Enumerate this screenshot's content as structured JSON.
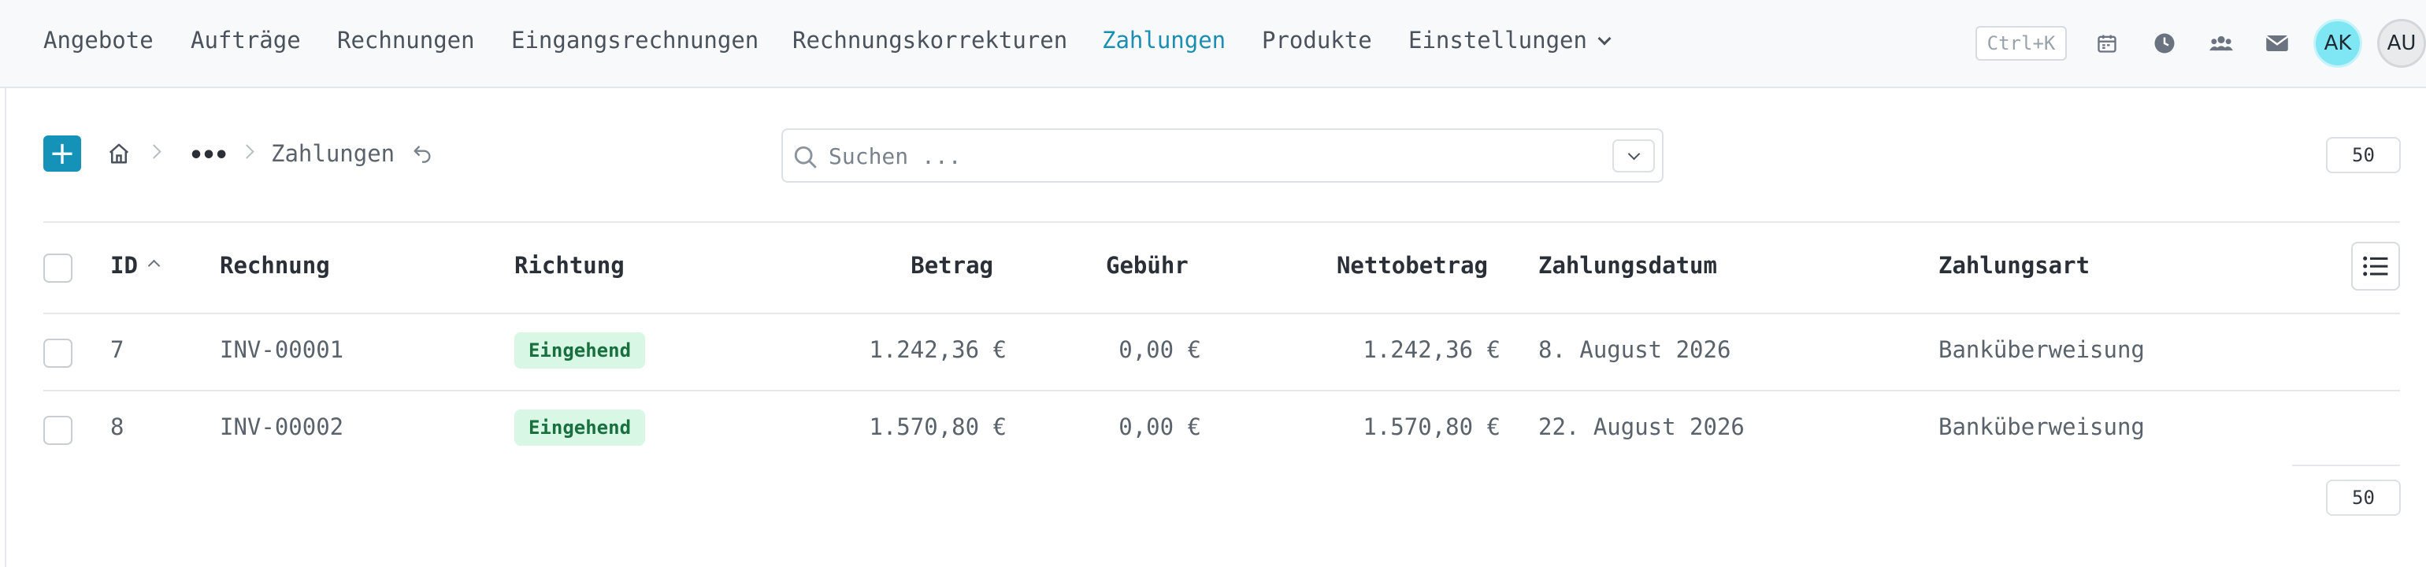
{
  "nav": {
    "items": [
      "Angebote",
      "Aufträge",
      "Rechnungen",
      "Eingangsrechnungen",
      "Rechnungskorrekturen",
      "Zahlungen",
      "Produkte",
      "Einstellungen"
    ],
    "active": "Zahlungen",
    "shortcut": "Ctrl+K",
    "icons": [
      "calendar-icon",
      "clock-icon",
      "team-icon",
      "mail-icon"
    ],
    "avatars": [
      "AK",
      "AU"
    ]
  },
  "toolbar": {
    "add_label": "+",
    "breadcrumb_current": "Zahlungen",
    "breadcrumb_more": "•••",
    "search_placeholder": "Suchen ...",
    "page_size_top": "50",
    "page_size_bottom": "50"
  },
  "table": {
    "headers": {
      "id": "ID",
      "rechnung": "Rechnung",
      "richtung": "Richtung",
      "betrag": "Betrag",
      "gebuehr": "Gebühr",
      "netto": "Nettobetrag",
      "datum": "Zahlungsdatum",
      "art": "Zahlungsart"
    },
    "rows": [
      {
        "id": "7",
        "rechnung": "INV-00001",
        "richtung": "Eingehend",
        "betrag": "1.242,36 €",
        "gebuehr": "0,00 €",
        "netto": "1.242,36 €",
        "datum": "8. August 2026",
        "art": "Banküberweisung"
      },
      {
        "id": "8",
        "rechnung": "INV-00002",
        "richtung": "Eingehend",
        "betrag": "1.570,80 €",
        "gebuehr": "0,00 €",
        "netto": "1.570,80 €",
        "datum": "22. August 2026",
        "art": "Banküberweisung"
      }
    ]
  },
  "colors": {
    "accent": "#1592b8",
    "active_nav": "#1a8fb3",
    "badge_bg": "#d8f7e4",
    "badge_text": "#19703f",
    "avatar_ak": "#7fe6f4"
  }
}
